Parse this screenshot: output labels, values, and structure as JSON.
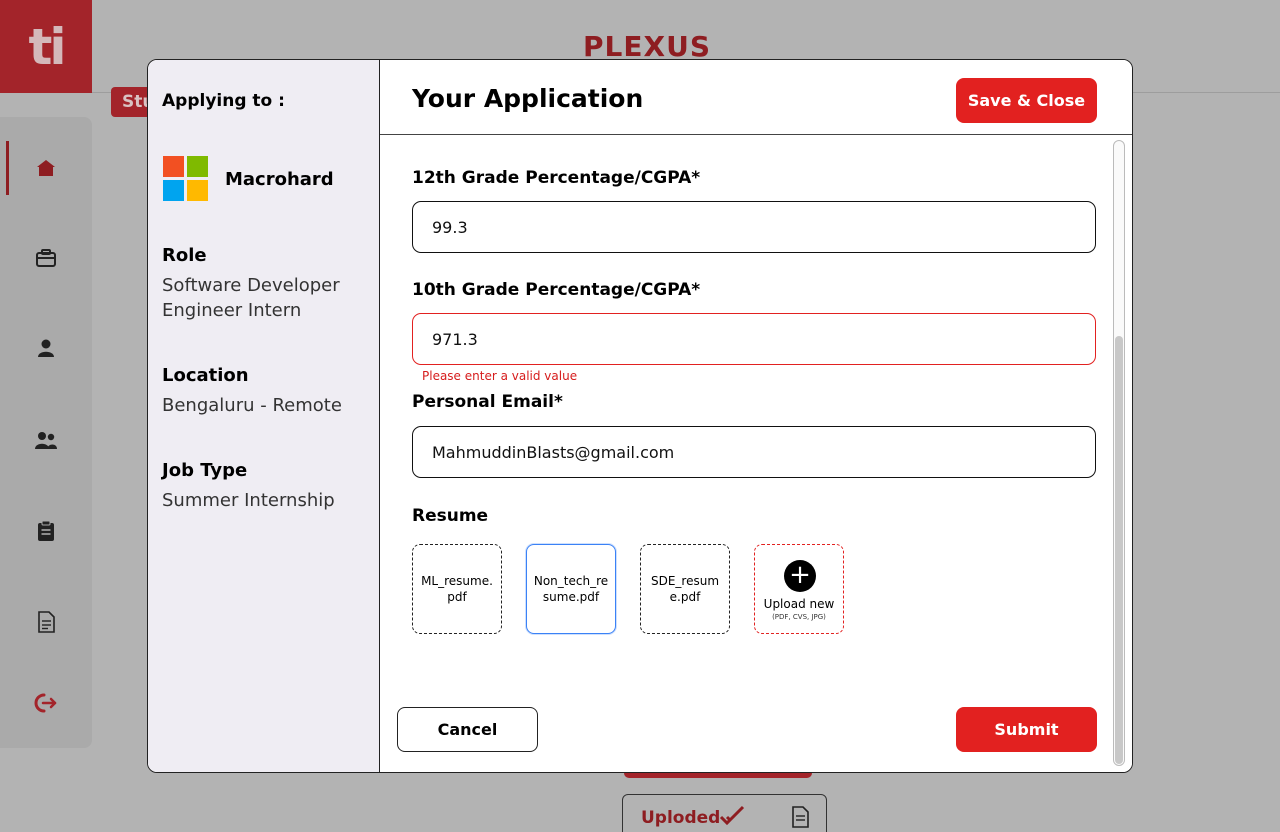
{
  "app": {
    "logo_text": "ti",
    "brand": "PLEXUS",
    "role_tag": "Stu",
    "uploaded_label": "Uploded"
  },
  "sidebar": {
    "items": [
      {
        "icon": "home-icon",
        "active": true
      },
      {
        "icon": "briefcase-icon",
        "active": false
      },
      {
        "icon": "user-icon",
        "active": false
      },
      {
        "icon": "users-icon",
        "active": false
      },
      {
        "icon": "clipboard-icon",
        "active": false
      },
      {
        "icon": "document-icon",
        "active": false
      },
      {
        "icon": "logout-icon",
        "active": false
      }
    ]
  },
  "modal": {
    "applying_to_label": "Applying to :",
    "company": "Macrohard",
    "role_label": "Role",
    "role_value": "Software Developer Engineer Intern",
    "location_label": "Location",
    "location_value": "Bengaluru - Remote",
    "job_type_label": "Job Type",
    "job_type_value": "Summer Internship",
    "title": "Your Application",
    "save_close": "Save & Close",
    "fields": [
      {
        "label": "12th Grade Percentage/CGPA*",
        "value": "99.3",
        "error": false
      },
      {
        "label": "10th Grade Percentage/CGPA*",
        "value": "971.3",
        "error": true
      },
      {
        "label": "Personal Email*",
        "value": "MahmuddinBlasts@gmail.com",
        "error": false
      }
    ],
    "error_message": "Please enter a valid value",
    "resume_label": "Resume",
    "resumes": [
      {
        "name": "ML_resume.pdf",
        "selected": false
      },
      {
        "name": "Non_tech_resume.pdf",
        "selected": true
      },
      {
        "name": "SDE_resume.pdf",
        "selected": false
      }
    ],
    "upload_label": "Upload new",
    "upload_formats": "(PDF, CVS, JPG)",
    "cancel": "Cancel",
    "submit": "Submit"
  },
  "colors": {
    "accent": "#e22120",
    "brand_dark": "#8e1d21",
    "selected_border": "#3b82f6",
    "left_panel_bg": "#efedf3"
  }
}
